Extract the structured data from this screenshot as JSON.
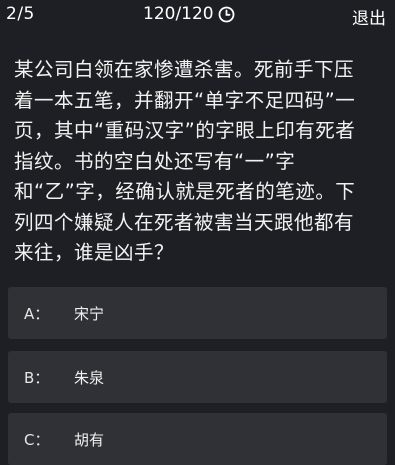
{
  "header": {
    "progress": "2/5",
    "timer": "120/120",
    "timer_icon": "clock-icon",
    "exit_label": "退出"
  },
  "question": {
    "lines": [
      "某公司白领在家惨遭杀害。死前手下压",
      "着一本五笔，并翻开“单字不足四码”一",
      "页，其中“重码汉字”的字眼上印有死者",
      "指纹。书的空白处还写有“一”字",
      "和“乙”字，经确认就是死者的笔迹。下",
      "列四个嫌疑人在死者被害当天跟他都有",
      "来往，谁是凶手？"
    ]
  },
  "options": [
    {
      "letter": "A：",
      "text": "宋宁"
    },
    {
      "letter": "B：",
      "text": "朱泉"
    },
    {
      "letter": "C：",
      "text": "胡有"
    }
  ]
}
